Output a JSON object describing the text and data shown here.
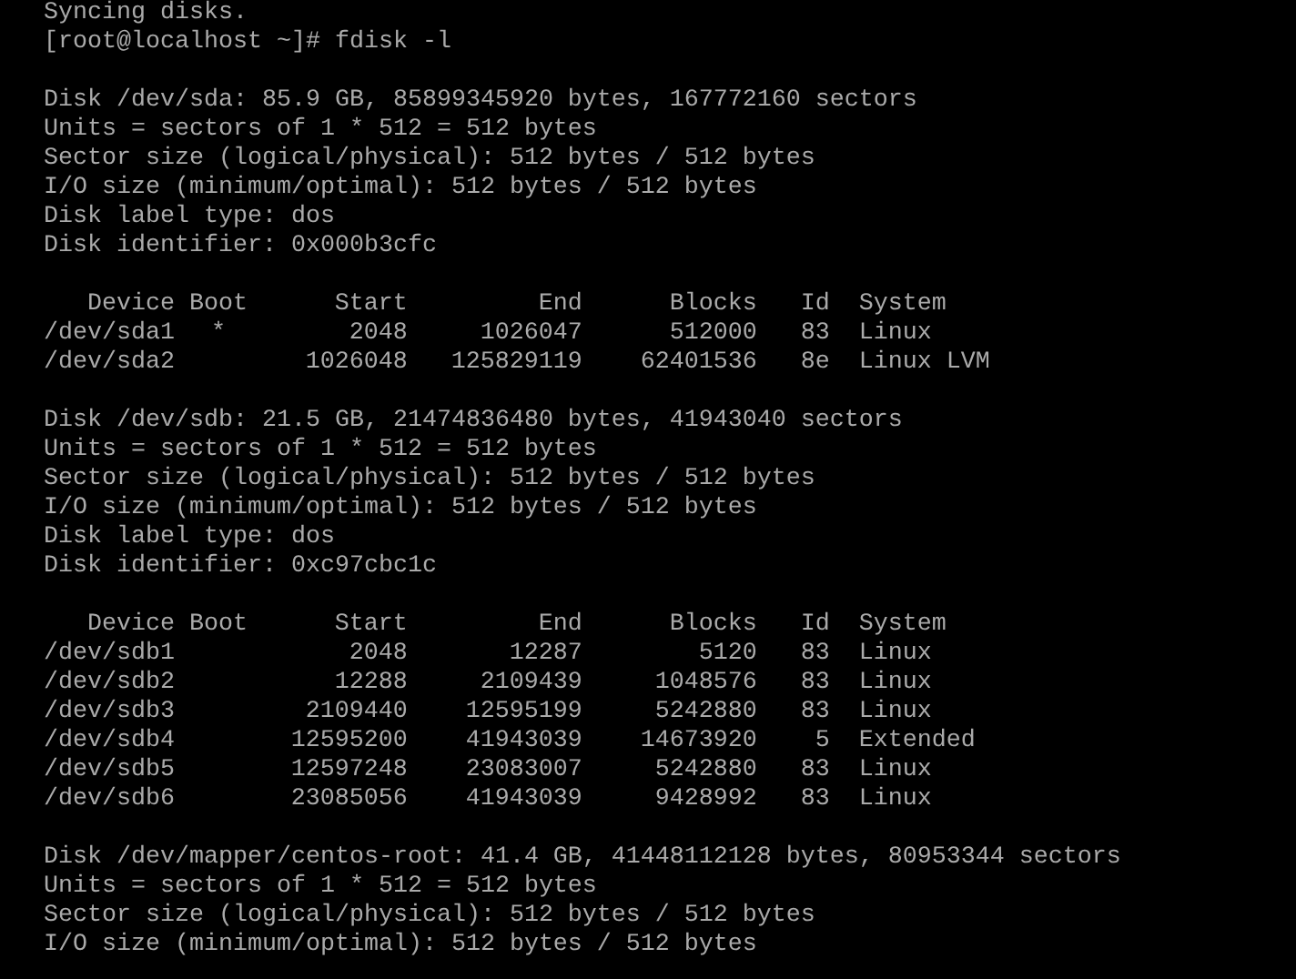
{
  "console": {
    "sections": [
      {
        "kind": "text",
        "lines": [
          "Syncing disks.",
          "[root@localhost ~]# fdisk -l"
        ]
      },
      {
        "kind": "text",
        "lines": [
          "Disk /dev/sda: 85.9 GB, 85899345920 bytes, 167772160 sectors",
          "Units = sectors of 1 * 512 = 512 bytes",
          "Sector size (logical/physical): 512 bytes / 512 bytes",
          "I/O size (minimum/optimal): 512 bytes / 512 bytes",
          "Disk label type: dos",
          "Disk identifier: 0x000b3cfc"
        ]
      },
      {
        "kind": "partitions",
        "columns": [
          "Device",
          "Boot",
          "Start",
          "End",
          "Blocks",
          "Id",
          "System"
        ],
        "rows": [
          {
            "device": "/dev/sda1",
            "boot": "*",
            "start": "2048",
            "end": "1026047",
            "blocks": "512000",
            "id": "83",
            "system": "Linux"
          },
          {
            "device": "/dev/sda2",
            "start": "1026048",
            "end": "125829119",
            "blocks": "62401536",
            "id": "8e",
            "system": "Linux LVM"
          }
        ]
      },
      {
        "kind": "text",
        "lines": [
          "Disk /dev/sdb: 21.5 GB, 21474836480 bytes, 41943040 sectors",
          "Units = sectors of 1 * 512 = 512 bytes",
          "Sector size (logical/physical): 512 bytes / 512 bytes",
          "I/O size (minimum/optimal): 512 bytes / 512 bytes",
          "Disk label type: dos",
          "Disk identifier: 0xc97cbc1c"
        ]
      },
      {
        "kind": "partitions",
        "columns": [
          "Device",
          "Boot",
          "Start",
          "End",
          "Blocks",
          "Id",
          "System"
        ],
        "rows": [
          {
            "device": "/dev/sdb1",
            "start": "2048",
            "end": "12287",
            "blocks": "5120",
            "id": "83",
            "system": "Linux"
          },
          {
            "device": "/dev/sdb2",
            "start": "12288",
            "end": "2109439",
            "blocks": "1048576",
            "id": "83",
            "system": "Linux"
          },
          {
            "device": "/dev/sdb3",
            "start": "2109440",
            "end": "12595199",
            "blocks": "5242880",
            "id": "83",
            "system": "Linux"
          },
          {
            "device": "/dev/sdb4",
            "start": "12595200",
            "end": "41943039",
            "blocks": "14673920",
            "id": "5",
            "system": "Extended"
          },
          {
            "device": "/dev/sdb5",
            "start": "12597248",
            "end": "23083007",
            "blocks": "5242880",
            "id": "83",
            "system": "Linux"
          },
          {
            "device": "/dev/sdb6",
            "start": "23085056",
            "end": "41943039",
            "blocks": "9428992",
            "id": "83",
            "system": "Linux"
          }
        ]
      },
      {
        "kind": "text",
        "lines": [
          "Disk /dev/mapper/centos-root: 41.4 GB, 41448112128 bytes, 80953344 sectors",
          "Units = sectors of 1 * 512 = 512 bytes",
          "Sector size (logical/physical): 512 bytes / 512 bytes",
          "I/O size (minimum/optimal): 512 bytes / 512 bytes"
        ]
      }
    ]
  }
}
